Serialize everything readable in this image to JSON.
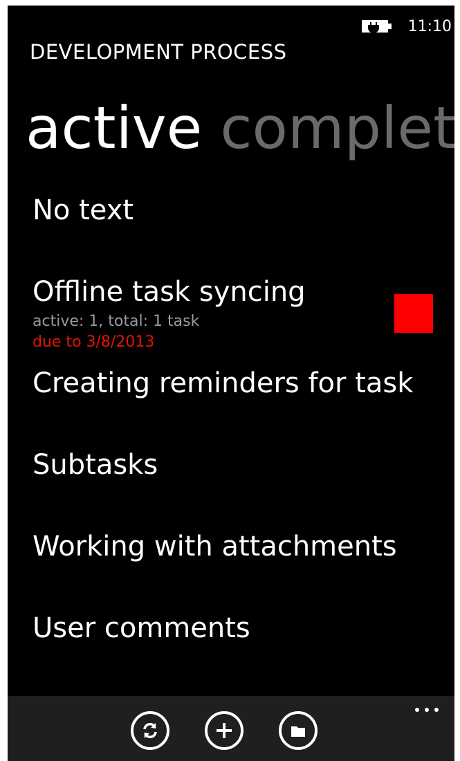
{
  "status_bar": {
    "time": "11:10",
    "battery_icon": "battery-charging-icon"
  },
  "app": {
    "title": "DEVELOPMENT PROCESS"
  },
  "pivot": {
    "tabs": [
      {
        "label": "active",
        "selected": true
      },
      {
        "label": "complet",
        "selected": false
      }
    ]
  },
  "tasks": [
    {
      "title": "No text"
    },
    {
      "title": "Offline task syncing",
      "subtitle": "active: 1, total: 1 task",
      "due": "due to 3/8/2013",
      "priority_color": "#ff0000"
    },
    {
      "title": "Creating reminders for task"
    },
    {
      "title": "Subtasks"
    },
    {
      "title": "Working with attachments"
    },
    {
      "title": "User comments"
    }
  ],
  "app_bar": {
    "buttons": [
      {
        "icon": "sync-icon"
      },
      {
        "icon": "add-icon"
      },
      {
        "icon": "folder-icon"
      }
    ],
    "more_icon": "more-ellipsis-icon"
  },
  "colors": {
    "background": "#000000",
    "accent_due": "#e51400",
    "priority": "#ff0000",
    "app_bar": "#1f1f1f"
  }
}
